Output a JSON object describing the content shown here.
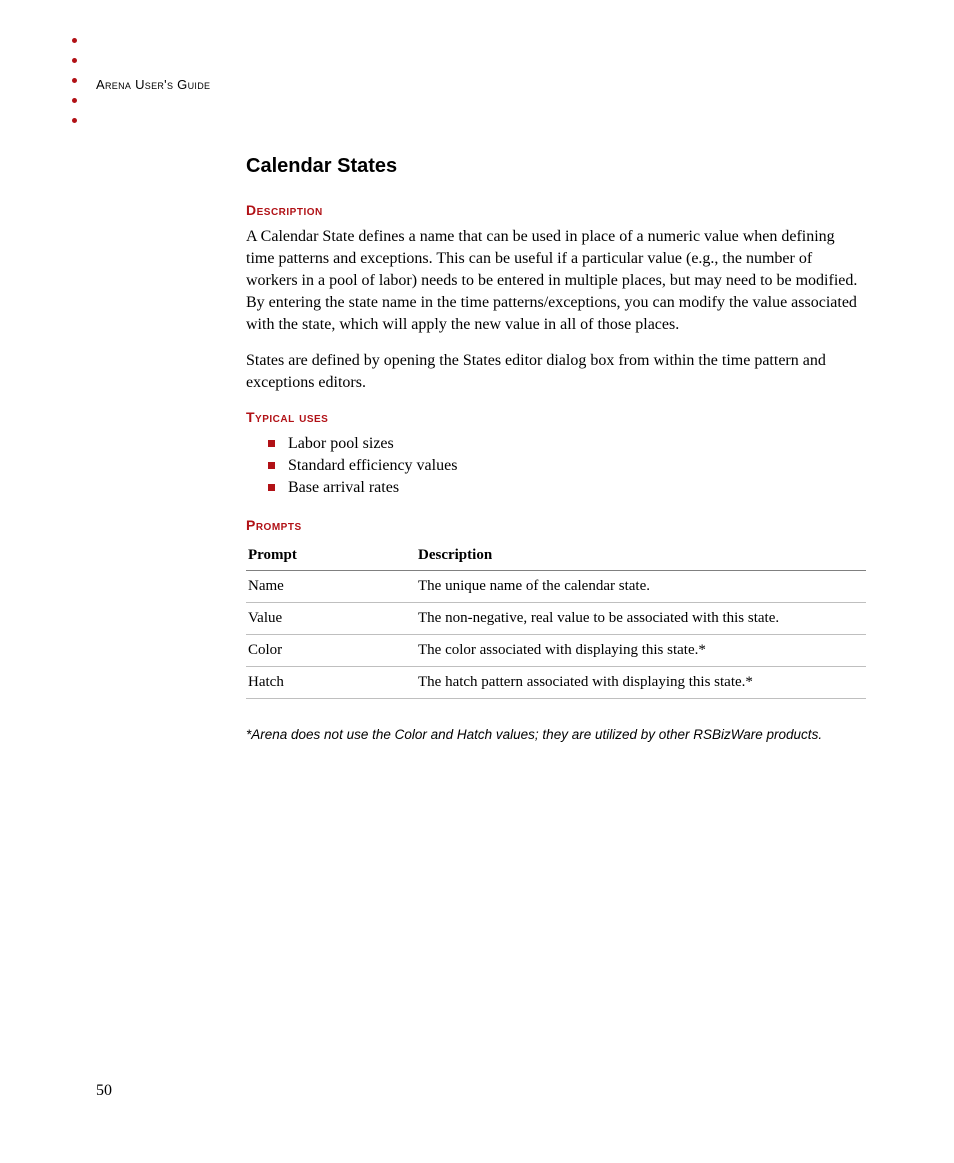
{
  "header": {
    "running_title": "Arena User's Guide"
  },
  "section": {
    "title": "Calendar States",
    "description_heading": "Description",
    "description_p1": "A Calendar State defines a name that can be used in place of a numeric value when defining time patterns and exceptions. This can be useful if a particular value (e.g., the number of workers in a pool of labor) needs to be entered in multiple places, but may need to be modified. By entering the state name in the time patterns/exceptions, you can modify the value associated with the state, which will apply the new value in all of those places.",
    "description_p2": "States are defined by opening the States editor dialog box from within the time pattern and exceptions editors.",
    "typical_uses_heading": "Typical uses",
    "typical_uses": [
      "Labor pool sizes",
      "Standard efficiency values",
      "Base arrival rates"
    ],
    "prompts_heading": "Prompts",
    "table": {
      "col_prompt": "Prompt",
      "col_description": "Description",
      "rows": [
        {
          "prompt": "Name",
          "description": "The unique name of the calendar state."
        },
        {
          "prompt": "Value",
          "description": "The non-negative, real value to be associated with this state."
        },
        {
          "prompt": "Color",
          "description": "The color associated with displaying this state.*"
        },
        {
          "prompt": "Hatch",
          "description": "The hatch pattern associated with displaying this state.*"
        }
      ]
    },
    "footnote": "*Arena does not use the Color and Hatch values; they are utilized by other RSBizWare products."
  },
  "page_number": "50"
}
